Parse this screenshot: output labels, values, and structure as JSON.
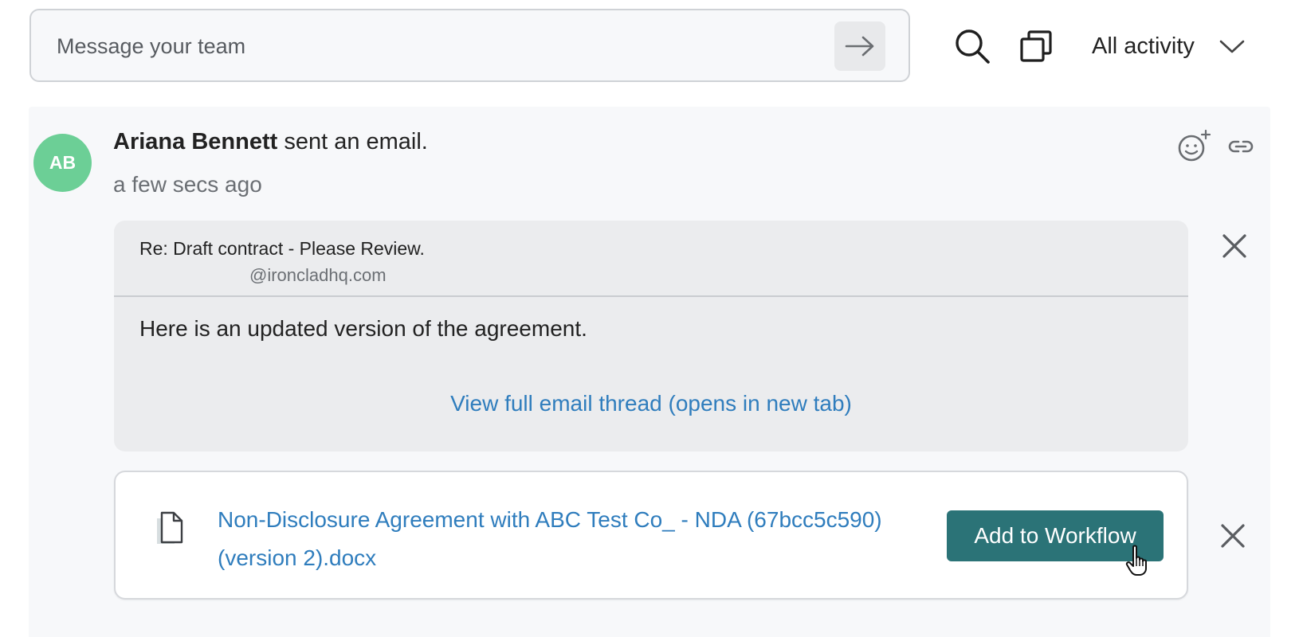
{
  "composer": {
    "placeholder": "Message your team"
  },
  "filter": {
    "label": "All activity"
  },
  "activity": {
    "avatar_initials": "AB",
    "avatar_color": "#6ccf96",
    "actor": "Ariana Bennett",
    "action": " sent an email.",
    "timestamp": "a few secs ago",
    "email": {
      "subject": "Re: Draft contract - Please Review.",
      "sender": "@ironcladhq.com",
      "body": "Here is an updated version of the agreement.",
      "thread_link": "View full email thread (opens in new tab)"
    },
    "attachment": {
      "file_name": "Non-Disclosure Agreement with ABC Test Co_ - NDA (67bcc5c590) (version 2).docx",
      "action_label": "Add to Workflow"
    }
  },
  "colors": {
    "link": "#2f7dbd",
    "primary_button": "#2b7377",
    "panel_bg": "#f7f8fa"
  }
}
